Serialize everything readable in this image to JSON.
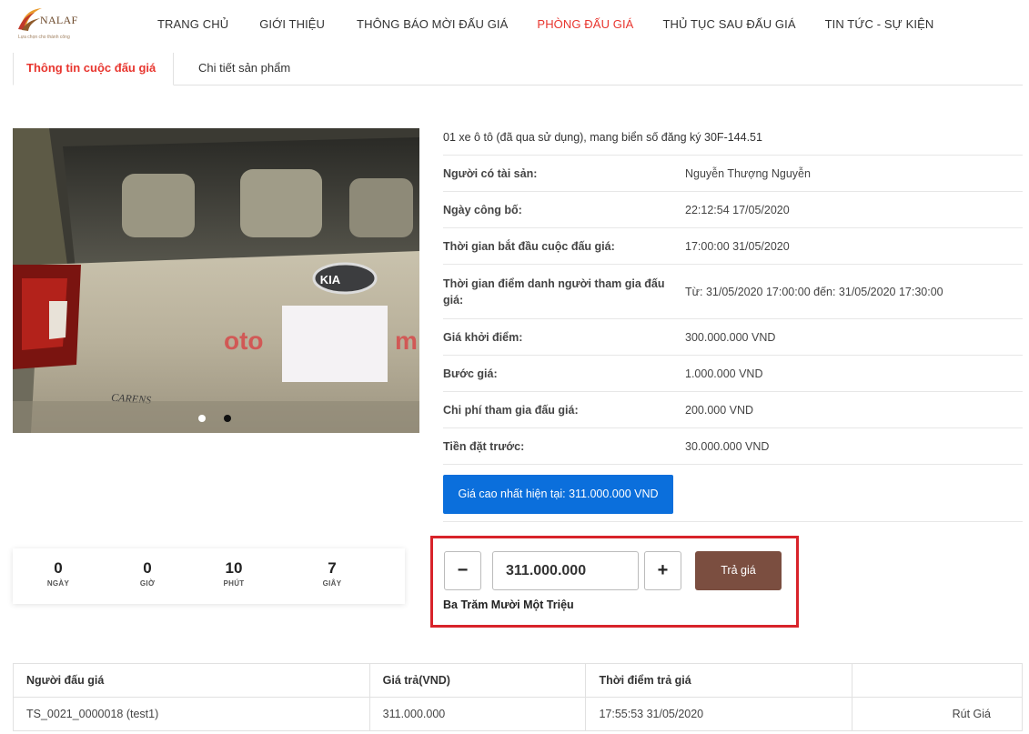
{
  "header": {
    "logo_text": "NALAF",
    "logo_tagline": "Lựa chọn cho thành công",
    "nav": [
      {
        "label": "TRANG CHỦ",
        "active": false
      },
      {
        "label": "GIỚI THIỆU",
        "active": false
      },
      {
        "label": "THÔNG BÁO MỜI ĐẤU GIÁ",
        "active": false
      },
      {
        "label": "PHÒNG ĐẤU GIÁ",
        "active": true
      },
      {
        "label": "THỦ TỤC SAU ĐẤU GIÁ",
        "active": false
      },
      {
        "label": "TIN TỨC - SỰ KIỆN",
        "active": false
      }
    ]
  },
  "tabs": {
    "info": "Thông tin cuộc đấu giá",
    "detail": "Chi tiết sản phẩm"
  },
  "photo": {
    "brand_badge": "KIA",
    "model_text": "CARENS",
    "watermark_left": "oto",
    "watermark_right": "m",
    "carousel_dots": 2,
    "active_dot": 2
  },
  "info": {
    "title": "01 xe ô tô (đã qua sử dụng), mang biển số đăng ký 30F-144.51",
    "rows": [
      {
        "label": "Người có tài sản:",
        "value": "Nguyễn Thượng Nguyễn"
      },
      {
        "label": "Ngày công bố:",
        "value": "22:12:54 17/05/2020"
      },
      {
        "label": "Thời gian bắt đầu cuộc đấu giá:",
        "value": "17:00:00 31/05/2020"
      },
      {
        "label": "Thời gian điểm danh người tham gia đấu giá:",
        "value": "Từ: 31/05/2020 17:00:00 đến: 31/05/2020 17:30:00"
      },
      {
        "label": "Giá khởi điểm:",
        "value": "300.000.000 VND"
      },
      {
        "label": "Bước giá:",
        "value": "1.000.000 VND"
      },
      {
        "label": "Chi phí tham gia đấu giá:",
        "value": "200.000 VND"
      },
      {
        "label": "Tiền đặt trước:",
        "value": "30.000.000 VND"
      }
    ],
    "highest_bid": "Giá cao nhất hiện tại: 311.000.000 VND"
  },
  "countdown": [
    {
      "value": "0",
      "label": "NGÀY"
    },
    {
      "value": "0",
      "label": "GIỜ"
    },
    {
      "value": "10",
      "label": "PHÚT"
    },
    {
      "value": "7",
      "label": "GIÂY"
    }
  ],
  "bid": {
    "minus": "−",
    "plus": "+",
    "amount": "311.000.000",
    "submit": "Trả giá",
    "amount_words": "Ba Trăm Mười Một Triệu"
  },
  "bids_table": {
    "headers": [
      "Người đấu giá",
      "Giá trả(VND)",
      "Thời điểm trả giá",
      ""
    ],
    "rows": [
      {
        "bidder": "TS_0021_0000018 (test1)",
        "price": "311.000.000",
        "time": "17:55:53 31/05/2020",
        "action": "Rút Giá"
      }
    ]
  },
  "colors": {
    "accent_red": "#e8362f",
    "primary_blue": "#0b6fdc",
    "bid_brown": "#7b4e40",
    "highlight_border": "#d8232a"
  }
}
